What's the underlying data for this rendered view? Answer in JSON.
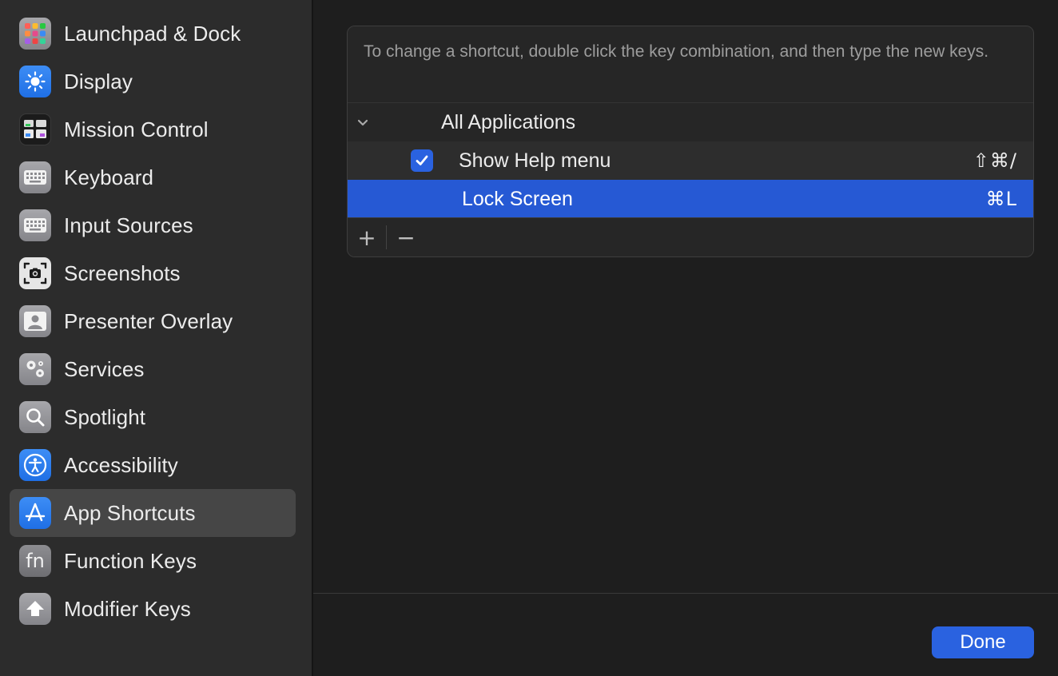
{
  "sidebar": {
    "items": [
      {
        "label": "Launchpad & Dock",
        "icon": "launchpad-icon"
      },
      {
        "label": "Display",
        "icon": "display-icon"
      },
      {
        "label": "Mission Control",
        "icon": "mission-control-icon"
      },
      {
        "label": "Keyboard",
        "icon": "keyboard-icon"
      },
      {
        "label": "Input Sources",
        "icon": "input-sources-icon"
      },
      {
        "label": "Screenshots",
        "icon": "screenshots-icon"
      },
      {
        "label": "Presenter Overlay",
        "icon": "presenter-overlay-icon"
      },
      {
        "label": "Services",
        "icon": "services-icon"
      },
      {
        "label": "Spotlight",
        "icon": "spotlight-icon"
      },
      {
        "label": "Accessibility",
        "icon": "accessibility-icon"
      },
      {
        "label": "App Shortcuts",
        "icon": "app-shortcuts-icon",
        "selected": true
      },
      {
        "label": "Function Keys",
        "icon": "function-keys-icon",
        "icon_text": "fn"
      },
      {
        "label": "Modifier Keys",
        "icon": "modifier-keys-icon"
      }
    ]
  },
  "main": {
    "instructions": "To change a shortcut, double click the key combination, and then type the new keys.",
    "group": {
      "label": "All Applications",
      "expanded": true
    },
    "shortcuts": [
      {
        "label": "Show Help menu",
        "keys": "⇧⌘/",
        "checked": true
      },
      {
        "label": "Lock Screen",
        "keys": "⌘L",
        "selected": true
      }
    ],
    "toolbar": {
      "add": "+",
      "remove": "−"
    },
    "done_label": "Done"
  },
  "colors": {
    "accent": "#2659d4",
    "sidebar_bg": "#2c2c2c",
    "main_bg": "#1e1e1e",
    "selected_sidebar": "#464646"
  }
}
